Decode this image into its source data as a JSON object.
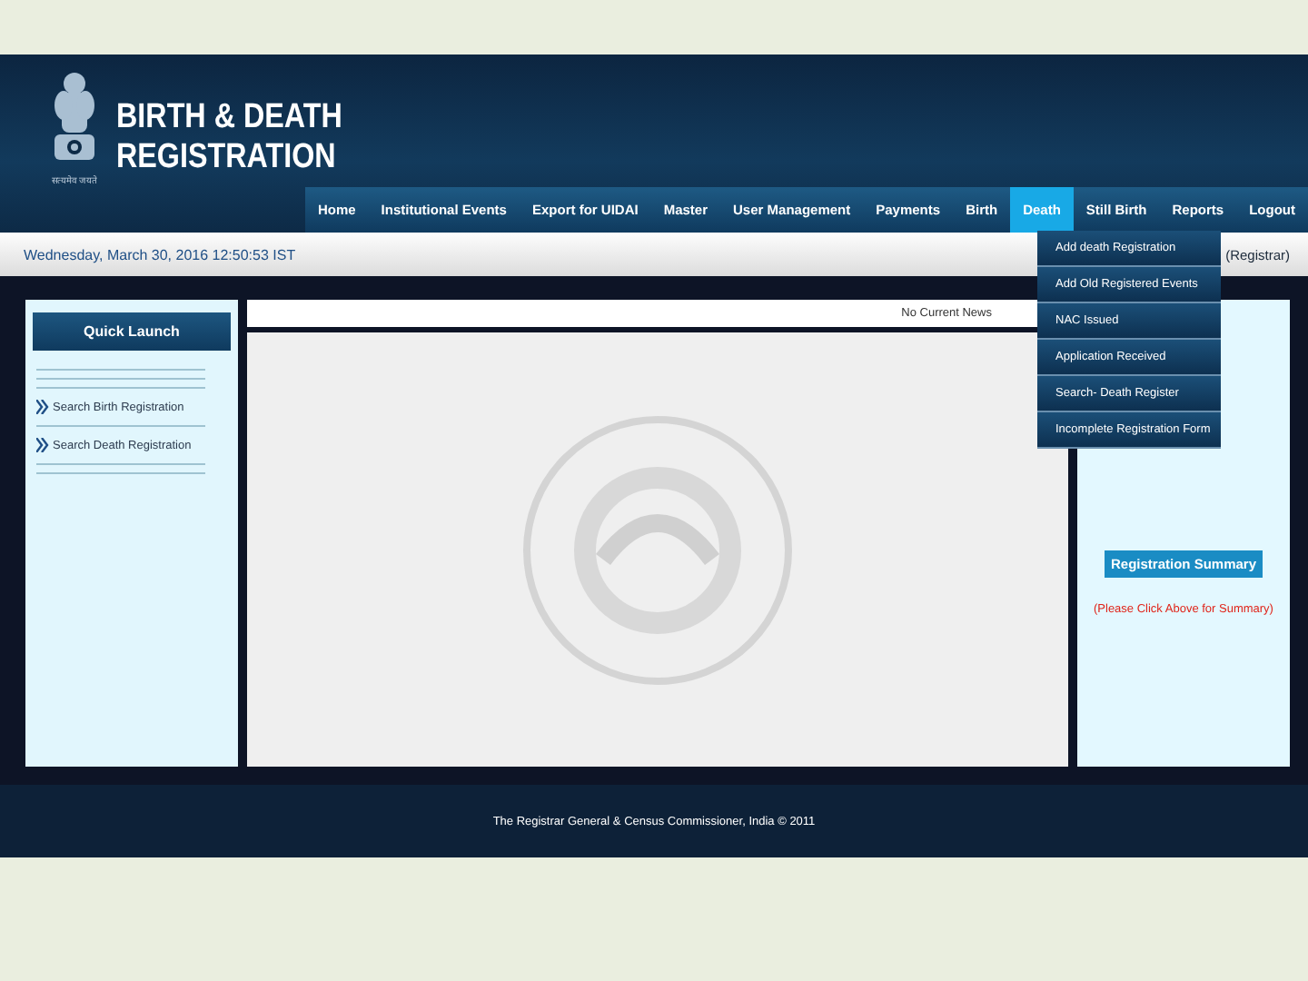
{
  "header": {
    "emblem_motto": "सत्यमेव जयते",
    "title_line_1": "BIRTH & DEATH",
    "title_line_2": "REGISTRATION"
  },
  "nav": [
    {
      "label": "Home",
      "selected": false
    },
    {
      "label": "Institutional Events",
      "selected": false
    },
    {
      "label": "Export for UIDAI",
      "selected": false
    },
    {
      "label": "Master",
      "selected": false
    },
    {
      "label": "User Management",
      "selected": false
    },
    {
      "label": "Payments",
      "selected": false
    },
    {
      "label": "Birth",
      "selected": false
    },
    {
      "label": "Death",
      "selected": true
    },
    {
      "label": "Still Birth",
      "selected": false
    },
    {
      "label": "Reports",
      "selected": false
    },
    {
      "label": "Logout",
      "selected": false
    }
  ],
  "nav_dropdown": [
    "Add death Registration",
    "Add Old Registered Events",
    "NAC Issued",
    "Application Received",
    "Search- Death Register",
    "Incomplete Registration Form"
  ],
  "date_bar": {
    "datetime": "Wednesday, March 30, 2016 12:50:53 IST",
    "role": "(Registrar)"
  },
  "quick_launch": {
    "title": "Quick Launch",
    "items": [
      "Search Birth Registration",
      "Search Death Registration"
    ]
  },
  "news": "No Current News",
  "summary": {
    "button": "Registration Summary",
    "hint": "(Please Click Above for Summary)"
  },
  "footer": "The Registrar General & Census Commissioner, India © 2011"
}
